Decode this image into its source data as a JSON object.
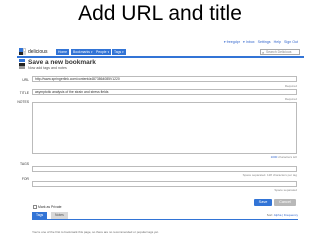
{
  "slide": {
    "title": "Add URL and title"
  },
  "top_links": [
    "▾ freegdpr",
    "▾ Inbox",
    "Settings",
    "Help",
    "Sign Out"
  ],
  "nav": {
    "brand": "delicious",
    "tabs": [
      {
        "label": "Home",
        "caret": ""
      },
      {
        "label": "Bookmarks",
        "caret": "▾"
      },
      {
        "label": "People",
        "caret": "▾"
      },
      {
        "label": "Tags",
        "caret": "▾"
      }
    ],
    "search_placeholder": "Search Delicious"
  },
  "logo_colors": [
    "#3274d6",
    "#222222",
    "#d6d6d6",
    "#ffffff"
  ],
  "accent": "#3274d6",
  "page": {
    "title": "Save a new bookmark",
    "subtitle": "Now add tags and notes"
  },
  "form": {
    "url_label": "URL",
    "url_value": "http://www.springerlink.com/content/a4873864085V1220",
    "url_hint": "Required",
    "title_label": "TITLE",
    "title_value": "asymptotic analysis of the strain and stress fields",
    "title_hint": "Required",
    "notes_label": "NOTES",
    "notes_value": "",
    "notes_hint_count": "1000",
    "notes_hint_text": "characters left",
    "tags_label": "TAGS",
    "tags_value": "",
    "tags_hint": "Space separated. 128 characters per tag",
    "for_label": "FOR",
    "for_value": "",
    "for_hint": "Space separated",
    "private_label": "Mark as Private",
    "save_label": "Save",
    "cancel_label": "Cancel"
  },
  "tabs": {
    "tags_label": "Tags",
    "notes_label": "Notes",
    "sort_prefix": "Sort:",
    "sort_options": "Alpha | Frequency",
    "note": "You're one of the first to bookmark this page, so there are no recommended or popular tags yet."
  }
}
